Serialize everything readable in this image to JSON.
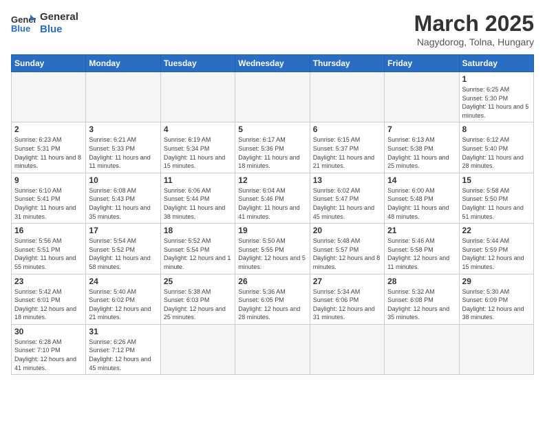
{
  "header": {
    "logo_general": "General",
    "logo_blue": "Blue",
    "title": "March 2025",
    "subtitle": "Nagydorog, Tolna, Hungary"
  },
  "weekdays": [
    "Sunday",
    "Monday",
    "Tuesday",
    "Wednesday",
    "Thursday",
    "Friday",
    "Saturday"
  ],
  "weeks": [
    [
      {
        "day": "",
        "info": ""
      },
      {
        "day": "",
        "info": ""
      },
      {
        "day": "",
        "info": ""
      },
      {
        "day": "",
        "info": ""
      },
      {
        "day": "",
        "info": ""
      },
      {
        "day": "",
        "info": ""
      },
      {
        "day": "1",
        "info": "Sunrise: 6:25 AM\nSunset: 5:30 PM\nDaylight: 11 hours and 5 minutes."
      }
    ],
    [
      {
        "day": "2",
        "info": "Sunrise: 6:23 AM\nSunset: 5:31 PM\nDaylight: 11 hours and 8 minutes."
      },
      {
        "day": "3",
        "info": "Sunrise: 6:21 AM\nSunset: 5:33 PM\nDaylight: 11 hours and 11 minutes."
      },
      {
        "day": "4",
        "info": "Sunrise: 6:19 AM\nSunset: 5:34 PM\nDaylight: 11 hours and 15 minutes."
      },
      {
        "day": "5",
        "info": "Sunrise: 6:17 AM\nSunset: 5:36 PM\nDaylight: 11 hours and 18 minutes."
      },
      {
        "day": "6",
        "info": "Sunrise: 6:15 AM\nSunset: 5:37 PM\nDaylight: 11 hours and 21 minutes."
      },
      {
        "day": "7",
        "info": "Sunrise: 6:13 AM\nSunset: 5:38 PM\nDaylight: 11 hours and 25 minutes."
      },
      {
        "day": "8",
        "info": "Sunrise: 6:12 AM\nSunset: 5:40 PM\nDaylight: 11 hours and 28 minutes."
      }
    ],
    [
      {
        "day": "9",
        "info": "Sunrise: 6:10 AM\nSunset: 5:41 PM\nDaylight: 11 hours and 31 minutes."
      },
      {
        "day": "10",
        "info": "Sunrise: 6:08 AM\nSunset: 5:43 PM\nDaylight: 11 hours and 35 minutes."
      },
      {
        "day": "11",
        "info": "Sunrise: 6:06 AM\nSunset: 5:44 PM\nDaylight: 11 hours and 38 minutes."
      },
      {
        "day": "12",
        "info": "Sunrise: 6:04 AM\nSunset: 5:46 PM\nDaylight: 11 hours and 41 minutes."
      },
      {
        "day": "13",
        "info": "Sunrise: 6:02 AM\nSunset: 5:47 PM\nDaylight: 11 hours and 45 minutes."
      },
      {
        "day": "14",
        "info": "Sunrise: 6:00 AM\nSunset: 5:48 PM\nDaylight: 11 hours and 48 minutes."
      },
      {
        "day": "15",
        "info": "Sunrise: 5:58 AM\nSunset: 5:50 PM\nDaylight: 11 hours and 51 minutes."
      }
    ],
    [
      {
        "day": "16",
        "info": "Sunrise: 5:56 AM\nSunset: 5:51 PM\nDaylight: 11 hours and 55 minutes."
      },
      {
        "day": "17",
        "info": "Sunrise: 5:54 AM\nSunset: 5:52 PM\nDaylight: 11 hours and 58 minutes."
      },
      {
        "day": "18",
        "info": "Sunrise: 5:52 AM\nSunset: 5:54 PM\nDaylight: 12 hours and 1 minute."
      },
      {
        "day": "19",
        "info": "Sunrise: 5:50 AM\nSunset: 5:55 PM\nDaylight: 12 hours and 5 minutes."
      },
      {
        "day": "20",
        "info": "Sunrise: 5:48 AM\nSunset: 5:57 PM\nDaylight: 12 hours and 8 minutes."
      },
      {
        "day": "21",
        "info": "Sunrise: 5:46 AM\nSunset: 5:58 PM\nDaylight: 12 hours and 11 minutes."
      },
      {
        "day": "22",
        "info": "Sunrise: 5:44 AM\nSunset: 5:59 PM\nDaylight: 12 hours and 15 minutes."
      }
    ],
    [
      {
        "day": "23",
        "info": "Sunrise: 5:42 AM\nSunset: 6:01 PM\nDaylight: 12 hours and 18 minutes."
      },
      {
        "day": "24",
        "info": "Sunrise: 5:40 AM\nSunset: 6:02 PM\nDaylight: 12 hours and 21 minutes."
      },
      {
        "day": "25",
        "info": "Sunrise: 5:38 AM\nSunset: 6:03 PM\nDaylight: 12 hours and 25 minutes."
      },
      {
        "day": "26",
        "info": "Sunrise: 5:36 AM\nSunset: 6:05 PM\nDaylight: 12 hours and 28 minutes."
      },
      {
        "day": "27",
        "info": "Sunrise: 5:34 AM\nSunset: 6:06 PM\nDaylight: 12 hours and 31 minutes."
      },
      {
        "day": "28",
        "info": "Sunrise: 5:32 AM\nSunset: 6:08 PM\nDaylight: 12 hours and 35 minutes."
      },
      {
        "day": "29",
        "info": "Sunrise: 5:30 AM\nSunset: 6:09 PM\nDaylight: 12 hours and 38 minutes."
      }
    ],
    [
      {
        "day": "30",
        "info": "Sunrise: 6:28 AM\nSunset: 7:10 PM\nDaylight: 12 hours and 41 minutes."
      },
      {
        "day": "31",
        "info": "Sunrise: 6:26 AM\nSunset: 7:12 PM\nDaylight: 12 hours and 45 minutes."
      },
      {
        "day": "",
        "info": ""
      },
      {
        "day": "",
        "info": ""
      },
      {
        "day": "",
        "info": ""
      },
      {
        "day": "",
        "info": ""
      },
      {
        "day": "",
        "info": ""
      }
    ]
  ]
}
